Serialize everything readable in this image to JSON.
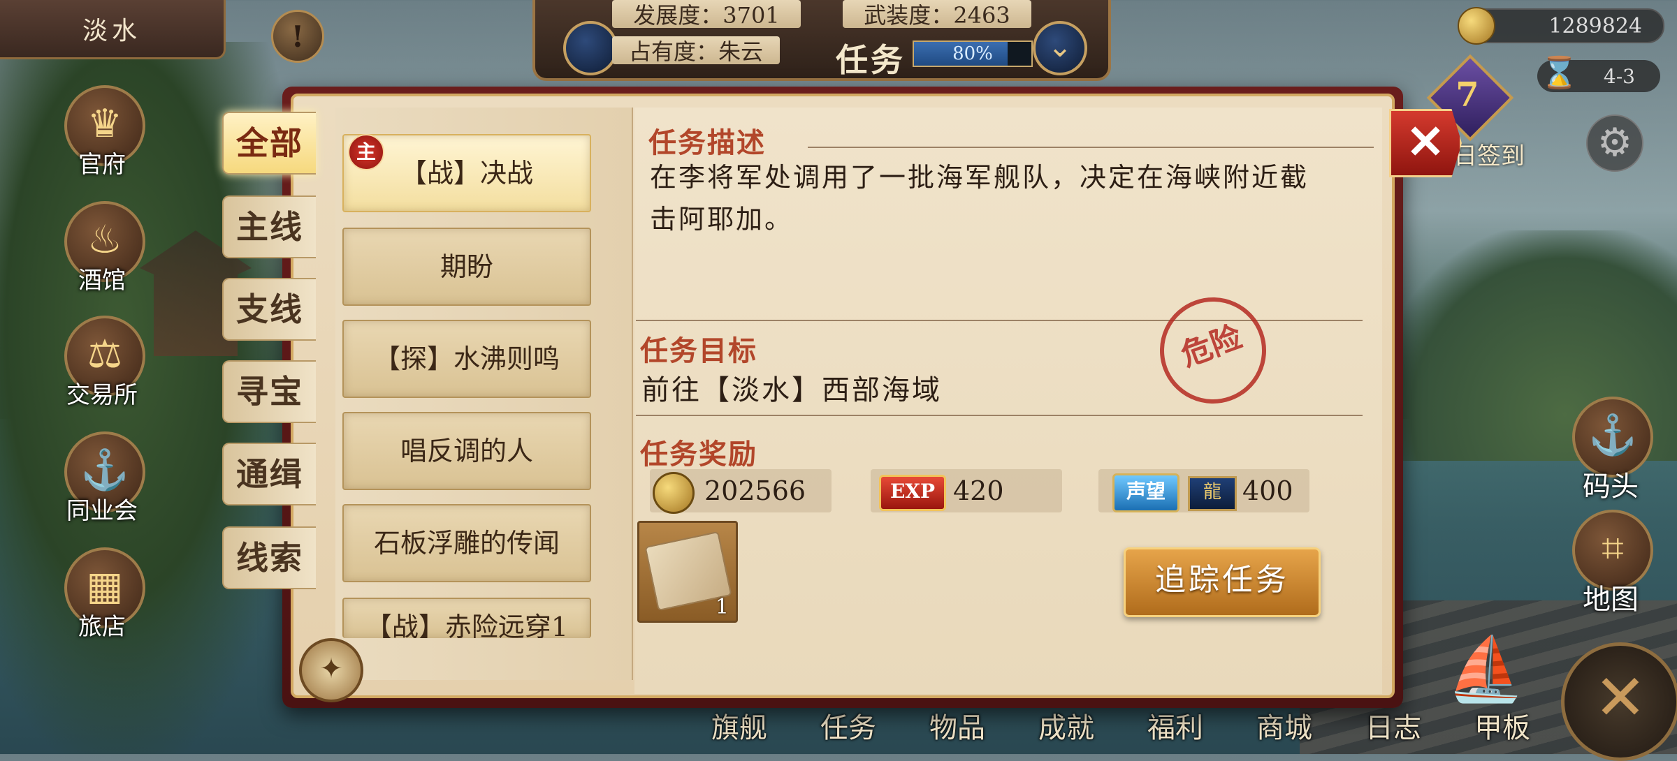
{
  "top": {
    "location": "淡水",
    "alert": "!",
    "stats": {
      "development": "发展度：3701",
      "armament": "武装度：2463",
      "occupancy": "占有度：朱云",
      "panel_title": "任务",
      "progress_text": "80%",
      "progress": 0.8
    },
    "gold": "1289824",
    "time": "4-3",
    "checkin": {
      "count": "7",
      "label": "日签到"
    },
    "settings_icon": "gear-icon"
  },
  "city_menu": [
    {
      "label": "官府",
      "icon": "crown-icon",
      "glyph": "♛"
    },
    {
      "label": "酒馆",
      "icon": "beer-mug-icon",
      "glyph": "♨"
    },
    {
      "label": "交易所",
      "icon": "scale-icon",
      "glyph": "⚖"
    },
    {
      "label": "同业会",
      "icon": "anchor-icon",
      "glyph": "⚓"
    },
    {
      "label": "旅店",
      "icon": "bed-icon",
      "glyph": "▦"
    }
  ],
  "right_nav": [
    {
      "label": "码头",
      "icon": "dock-icon",
      "glyph": "⚓"
    },
    {
      "label": "地图",
      "icon": "map-icon",
      "glyph": "⌗"
    }
  ],
  "bottom_menu": [
    "旗舰",
    "任务",
    "物品",
    "成就",
    "福利",
    "商城",
    "日志",
    "甲板"
  ],
  "category_tabs": [
    "全部",
    "主线",
    "支线",
    "寻宝",
    "通缉",
    "线索"
  ],
  "quests": [
    {
      "label": "【战】决战",
      "badge": "主"
    },
    {
      "label": "期盼"
    },
    {
      "label": "【探】水沸则鸣"
    },
    {
      "label": "唱反调的人"
    },
    {
      "label": "石板浮雕的传闻"
    },
    {
      "label": "【战】赤险远穿1"
    }
  ],
  "detail": {
    "desc_title": "任务描述",
    "desc_text": "在李将军处调用了一批海军舰队，决定在海峡附近截击阿耶加。",
    "target_title": "任务目标",
    "target_text": "前往【淡水】西部海域",
    "stamp": "危险",
    "reward_title": "任务奖励",
    "rewards": {
      "gold": "202566",
      "exp_label": "EXP",
      "exp": "420",
      "rep_label": "声望",
      "rep": "400",
      "item_count": "1"
    },
    "track_button": "追踪任务"
  },
  "close": "✕",
  "compass": "✦"
}
